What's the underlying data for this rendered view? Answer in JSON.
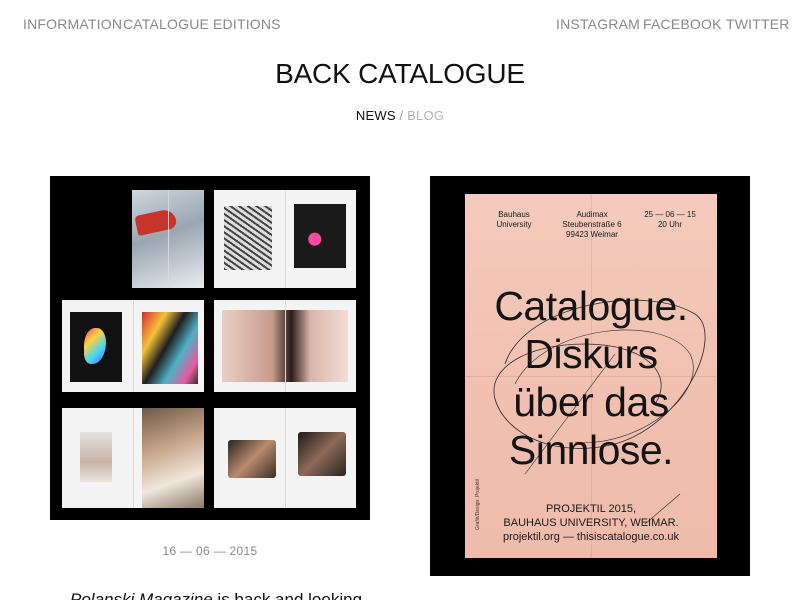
{
  "nav": {
    "left": [
      "INFORMATION",
      "CATALOGUE",
      "EDITIONS"
    ],
    "right": [
      "INSTAGRAM",
      "FACEBOOK",
      "TWITTER"
    ]
  },
  "page": {
    "title": "BACK CATALOGUE",
    "tabs": {
      "news": "NEWS",
      "separator": "/",
      "blog": "BLOG"
    }
  },
  "posts": [
    {
      "date": "16 — 06 — 2015",
      "excerpt_title": "Polanski Magazine",
      "excerpt_rest": " is back and looking"
    }
  ],
  "poster": {
    "col1": [
      "Bauhaus",
      "University"
    ],
    "col2": [
      "Audimax",
      "Steubenstraße 6",
      "99423 Weimar"
    ],
    "col3": [
      "25 — 06 — 15",
      "20 Uhr"
    ],
    "headline": [
      "Catalogue.",
      "Diskurs",
      "über das",
      "Sinnlose."
    ],
    "footer": [
      "PROJEKTIL 2015,",
      "BAUHAUS UNIVERSITY, WEIMAR.",
      "projektil.org — thisiscatalogue.co.uk"
    ],
    "side": "Grafik/Design: Projektil"
  },
  "colors": {
    "nav_text": "#8a8a8a",
    "title_text": "#111111",
    "blog_tab": "#b3b3b3",
    "poster_bg": "#f2c4b5",
    "card_bg": "#000000"
  }
}
